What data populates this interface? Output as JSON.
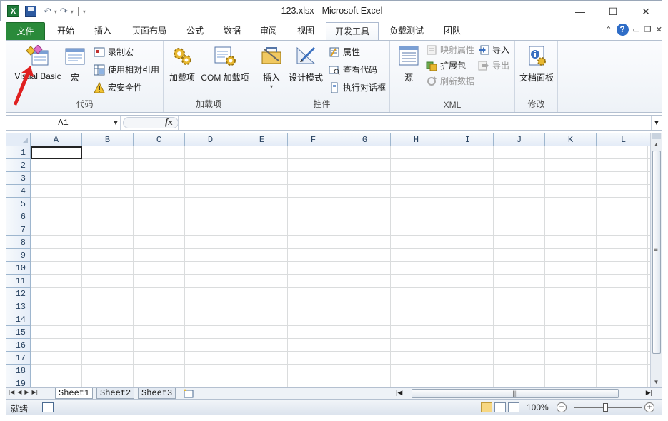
{
  "window": {
    "title": "123.xlsx - Microsoft Excel",
    "app_icon_letter": "X",
    "controls": {
      "minimize": "—",
      "restore": "☐",
      "close": "✕"
    }
  },
  "tabs": [
    {
      "label": "文件"
    },
    {
      "label": "开始"
    },
    {
      "label": "插入"
    },
    {
      "label": "页面布局"
    },
    {
      "label": "公式"
    },
    {
      "label": "数据"
    },
    {
      "label": "审阅"
    },
    {
      "label": "视图"
    },
    {
      "label": "开发工具"
    },
    {
      "label": "负载测试"
    },
    {
      "label": "团队"
    }
  ],
  "active_tab": "开发工具",
  "help_label": "?",
  "ribbon": {
    "code": {
      "label": "代码",
      "visual_basic": "Visual Basic",
      "macros": "宏",
      "record_macro": "录制宏",
      "relative_refs": "使用相对引用",
      "macro_security": "宏安全性"
    },
    "addins": {
      "label": "加载项",
      "addins": "加载项",
      "com_addins": "COM 加载项"
    },
    "controls": {
      "label": "控件",
      "insert": "插入",
      "design_mode": "设计模式",
      "properties": "属性",
      "view_code": "查看代码",
      "run_dialog": "执行对话框"
    },
    "xml": {
      "label": "XML",
      "source": "源",
      "map_properties": "映射属性",
      "expansion_packs": "扩展包",
      "refresh_data": "刷新数据",
      "import": "导入",
      "export": "导出"
    },
    "modify": {
      "label": "修改",
      "document_panel": "文档面板"
    }
  },
  "formula_bar": {
    "name_box": "A1",
    "fx": "fx",
    "formula": ""
  },
  "columns": [
    "A",
    "B",
    "C",
    "D",
    "E",
    "F",
    "G",
    "H",
    "I",
    "J",
    "K",
    "L"
  ],
  "rows": [
    "1",
    "2",
    "3",
    "4",
    "5",
    "6",
    "7",
    "8",
    "9",
    "10",
    "11",
    "12",
    "13",
    "14",
    "15",
    "16",
    "17",
    "18",
    "19"
  ],
  "sheets": [
    "Sheet1",
    "Sheet2",
    "Sheet3"
  ],
  "active_sheet": "Sheet1",
  "status": {
    "ready": "就绪",
    "zoom": "100%"
  },
  "colors": {
    "file_tab": "#2a8a3a",
    "ribbon_bg": "#eef2f7",
    "grid_line": "#dadcdd",
    "header_bg": "#e4ecf7",
    "annotation_arrow": "#e02020"
  }
}
